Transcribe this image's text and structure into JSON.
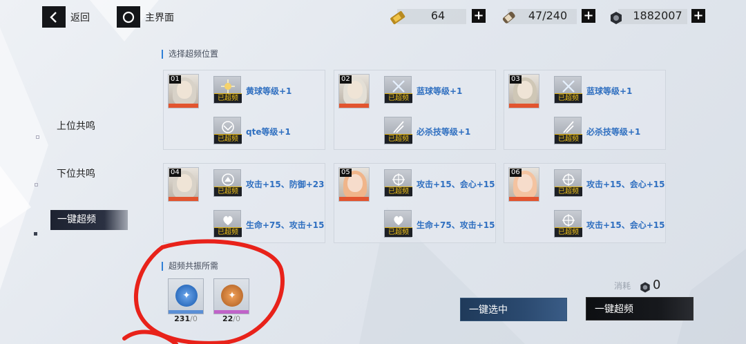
{
  "topbar": {
    "back_label": "返回",
    "home_label": "主界面",
    "resources": [
      {
        "name": "battery-ticket-icon",
        "value": "64"
      },
      {
        "name": "core-cylinder-icon",
        "value": "47/240"
      },
      {
        "name": "nut-currency-icon",
        "value": "1882007"
      }
    ],
    "plus": "+"
  },
  "menu": {
    "items": [
      "上位共鸣",
      "下位共鸣"
    ],
    "active": "一键超频"
  },
  "select_section": {
    "title": "选择超频位置"
  },
  "slots": [
    {
      "num": "01",
      "skills": [
        {
          "text": "黄球等级+1",
          "status": "已超频"
        },
        {
          "text": "qte等级+1",
          "status": "已超频"
        }
      ]
    },
    {
      "num": "02",
      "skills": [
        {
          "text": "蓝球等级+1",
          "status": "已超频"
        },
        {
          "text": "必杀技等级+1",
          "status": "已超频"
        }
      ]
    },
    {
      "num": "03",
      "skills": [
        {
          "text": "蓝球等级+1",
          "status": "已超频"
        },
        {
          "text": "必杀技等级+1",
          "status": "已超频"
        }
      ]
    },
    {
      "num": "04",
      "skills": [
        {
          "text": "攻击+15、防御+23",
          "status": "已超频"
        },
        {
          "text": "生命+75、攻击+15",
          "status": "已超频"
        }
      ]
    },
    {
      "num": "05",
      "skills": [
        {
          "text": "攻击+15、会心+15",
          "status": "已超频"
        },
        {
          "text": "生命+75、攻击+15",
          "status": "已超频"
        }
      ]
    },
    {
      "num": "06",
      "skills": [
        {
          "text": "攻击+15、会心+15",
          "status": "已超频"
        },
        {
          "text": "攻击+15、会心+15",
          "status": "已超频"
        }
      ]
    }
  ],
  "required_section": {
    "title": "超频共振所需",
    "items": [
      {
        "count": "231",
        "req": "/0",
        "color": "#2f6fc0"
      },
      {
        "count": "22",
        "req": "/0",
        "color": "#c07030"
      }
    ]
  },
  "consume": {
    "label": "消耗",
    "value": "0"
  },
  "buttons": {
    "select_all": "一键选中",
    "overclock_all": "一键超频"
  }
}
